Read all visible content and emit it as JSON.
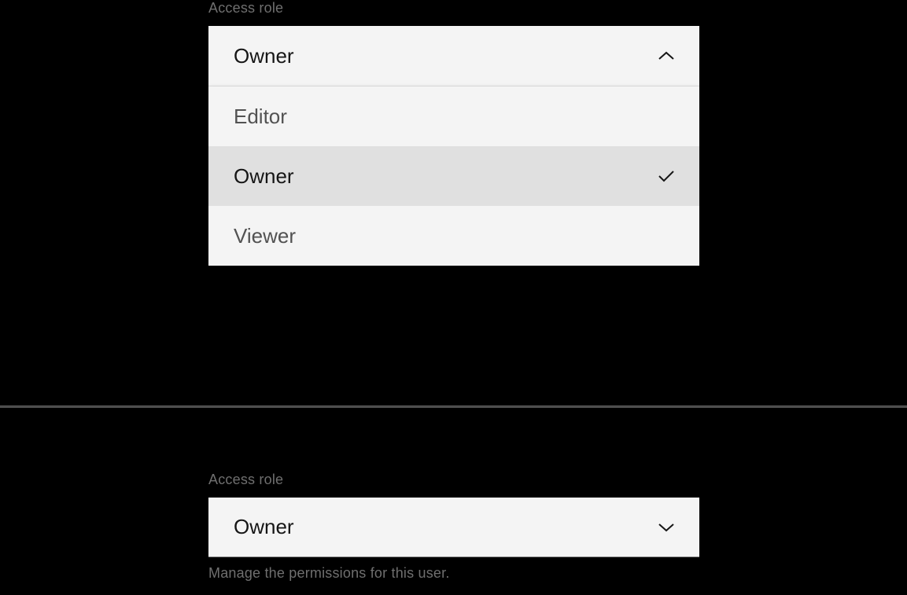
{
  "open_dropdown": {
    "label": "Access role",
    "selected_value": "Owner",
    "options": [
      {
        "label": "Editor",
        "selected": false
      },
      {
        "label": "Owner",
        "selected": true
      },
      {
        "label": "Viewer",
        "selected": false
      }
    ]
  },
  "closed_dropdown": {
    "label": "Access role",
    "selected_value": "Owner",
    "helper_text": "Manage the permissions for this user."
  }
}
